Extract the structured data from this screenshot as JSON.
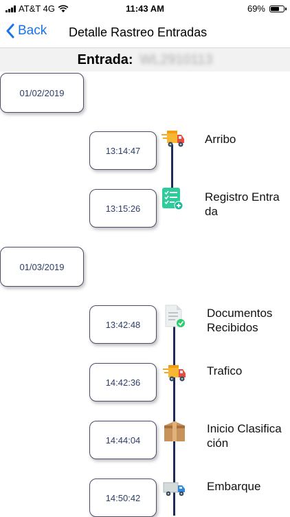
{
  "status_bar": {
    "carrier": "AT&T 4G",
    "time": "11:43 AM",
    "battery_percent": "69%",
    "battery_level": 0.69
  },
  "nav": {
    "back_label": "Back",
    "title": "Detalle Rastreo Entradas"
  },
  "entry": {
    "label": "Entrada:",
    "id": "WL2910113"
  },
  "groups": [
    {
      "date": "01/02/2019",
      "events": [
        {
          "time": "13:14:47",
          "label": "Arribo",
          "icon": "delivery-truck-icon"
        },
        {
          "time": "13:15:26",
          "label": "Registro Entrada",
          "icon": "checklist-icon"
        }
      ]
    },
    {
      "date": "01/03/2019",
      "events": [
        {
          "time": "13:42:48",
          "label": "Documentos Recibidos",
          "icon": "document-check-icon"
        },
        {
          "time": "14:42:36",
          "label": "Trafico",
          "icon": "delivery-truck-icon"
        },
        {
          "time": "14:44:04",
          "label": "Inicio Clasificación",
          "icon": "box-icon"
        },
        {
          "time": "14:50:42",
          "label": "Embarque",
          "icon": "truck-icon"
        }
      ]
    }
  ]
}
